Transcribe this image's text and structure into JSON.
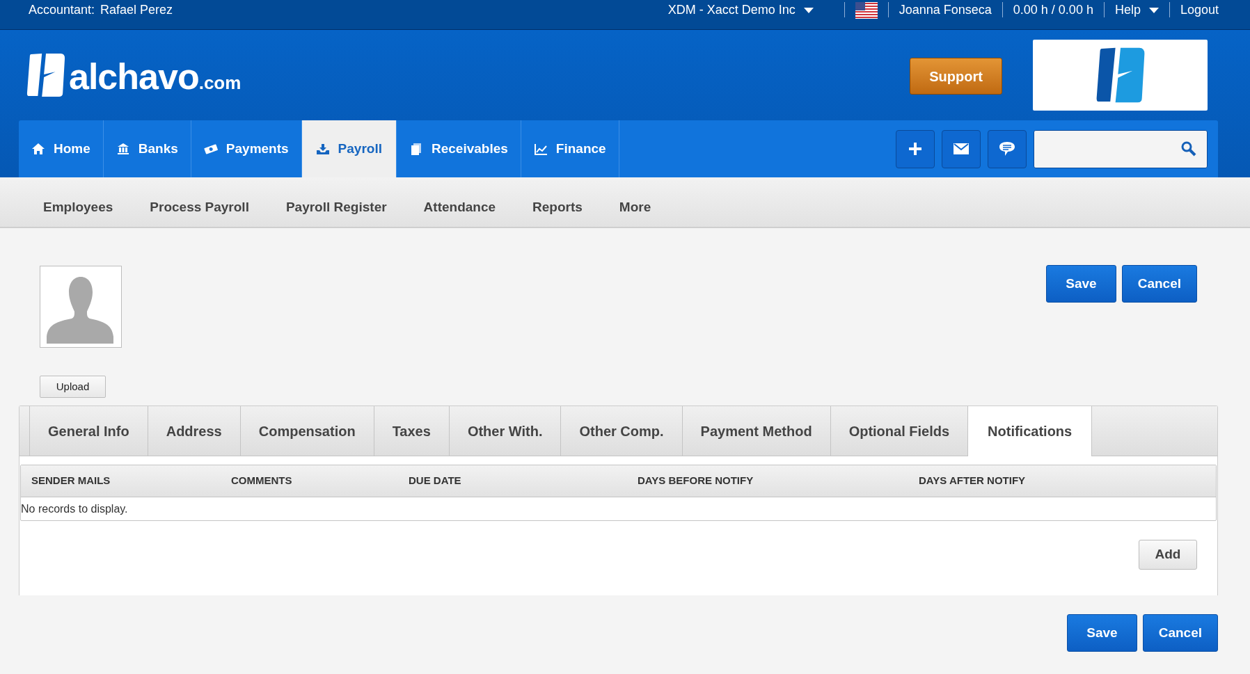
{
  "top_bar": {
    "accountant_label": "Accountant:",
    "accountant_name": "Rafael Perez",
    "company": "XDM - Xacct Demo Inc",
    "user": "Joanna Fonseca",
    "hours": "0.00 h / 0.00 h",
    "help": "Help",
    "logout": "Logout"
  },
  "header": {
    "logo_text": "alchavo",
    "logo_suffix": ".com",
    "support": "Support"
  },
  "main_nav": [
    {
      "label": "Home",
      "selected": false
    },
    {
      "label": "Banks",
      "selected": false
    },
    {
      "label": "Payments",
      "selected": false
    },
    {
      "label": "Payroll",
      "selected": true
    },
    {
      "label": "Receivables",
      "selected": false
    },
    {
      "label": "Finance",
      "selected": false
    }
  ],
  "sub_nav": [
    "Employees",
    "Process Payroll",
    "Payroll Register",
    "Attendance",
    "Reports",
    "More"
  ],
  "upload": "Upload",
  "top_actions": [
    "Save",
    "Cancel"
  ],
  "tabs": [
    {
      "label": "General Info",
      "selected": false
    },
    {
      "label": "Address",
      "selected": false
    },
    {
      "label": "Compensation",
      "selected": false
    },
    {
      "label": "Taxes",
      "selected": false
    },
    {
      "label": "Other With.",
      "selected": false
    },
    {
      "label": "Other Comp.",
      "selected": false
    },
    {
      "label": "Payment Method",
      "selected": false
    },
    {
      "label": "Optional Fields",
      "selected": false
    },
    {
      "label": "Notifications",
      "selected": true
    }
  ],
  "table": {
    "columns": [
      "SENDER MAILS",
      "COMMENTS",
      "DUE DATE",
      "DAYS BEFORE NOTIFY",
      "DAYS AFTER NOTIFY"
    ],
    "empty_message": "No records to display."
  },
  "add": "Add",
  "bottom_actions": [
    "Save",
    "Cancel"
  ]
}
